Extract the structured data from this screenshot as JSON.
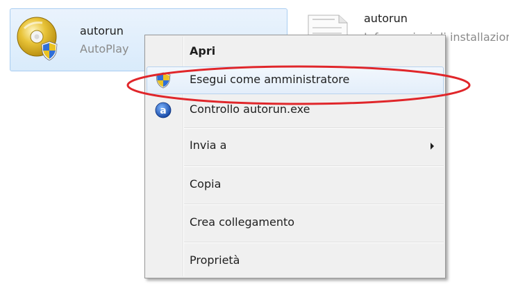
{
  "files": [
    {
      "name": "autorun",
      "type": "AutoPlay",
      "icon": "autoplay-disc-icon"
    },
    {
      "name": "autorun",
      "type": "Informazioni di installazione",
      "icon": "setup-info-file-icon"
    }
  ],
  "menu": {
    "open": {
      "label": "Apri"
    },
    "run_as_admin": {
      "label": "Esegui come amministratore",
      "icon": "uac-shield-icon"
    },
    "scan": {
      "label": "Controllo autorun.exe",
      "icon": "antivirus-icon"
    },
    "send_to": {
      "label": "Invia a"
    },
    "copy": {
      "label": "Copia"
    },
    "create_shortcut": {
      "label": "Crea collegamento"
    },
    "properties": {
      "label": "Proprietà"
    }
  },
  "colors": {
    "highlight_ellipse": "#e0262a",
    "selection_fill": "#d9ebfb",
    "menu_background": "#f0f0f0"
  }
}
